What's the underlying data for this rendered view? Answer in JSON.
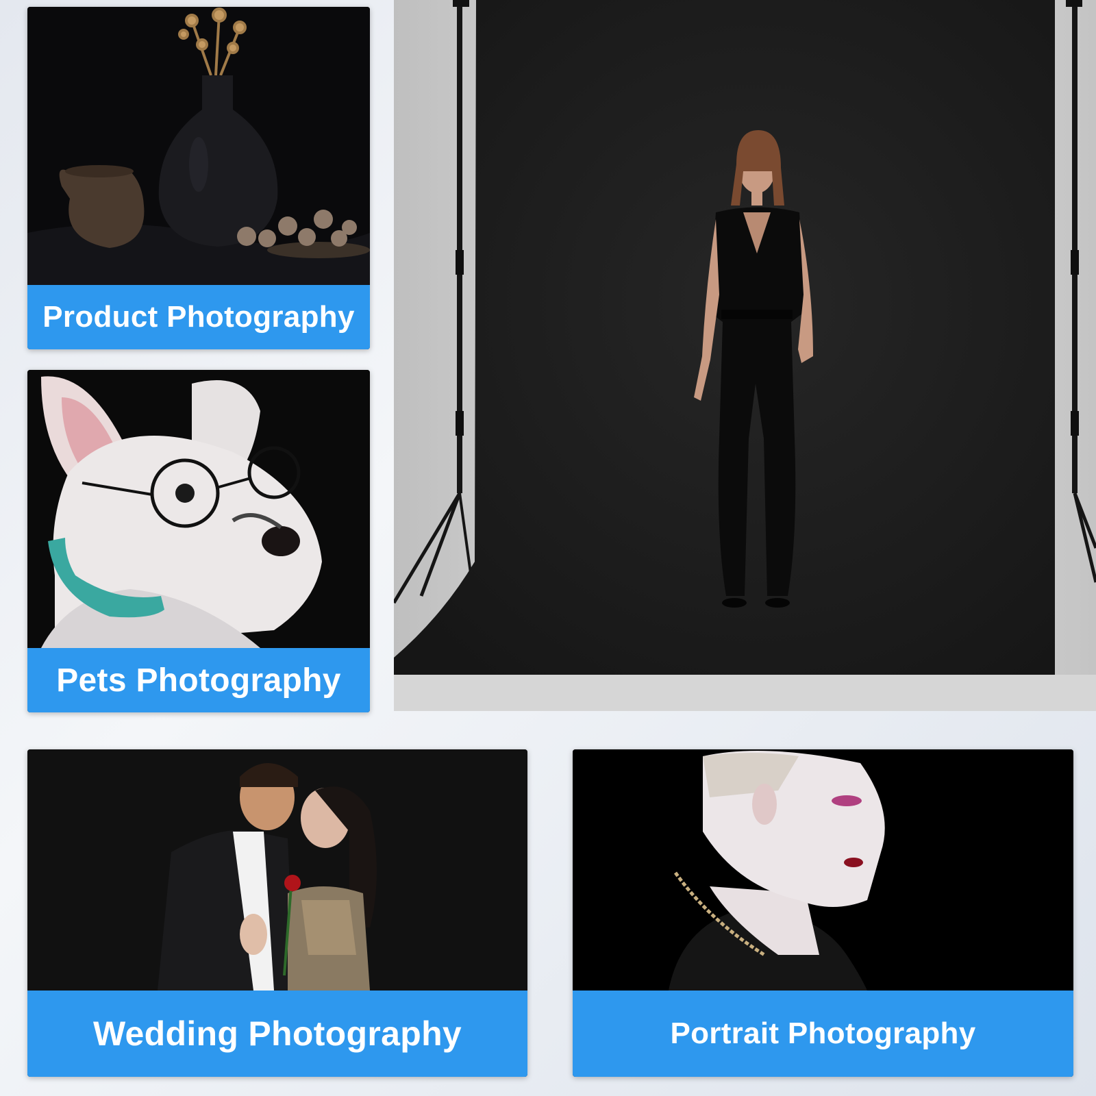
{
  "cards": [
    {
      "id": "product",
      "label": "Product Photography"
    },
    {
      "id": "pets",
      "label": "Pets Photography"
    },
    {
      "id": "wedding",
      "label": "Wedding Photography"
    },
    {
      "id": "portrait",
      "label": "Portrait Photography"
    }
  ],
  "colors": {
    "caption_blue": "#2e98ee",
    "backdrop_black": "#1c1c1c",
    "page_background": "#eef1f5"
  },
  "icons": [
    "backdrop-stand-icon",
    "model-figure-icon"
  ]
}
